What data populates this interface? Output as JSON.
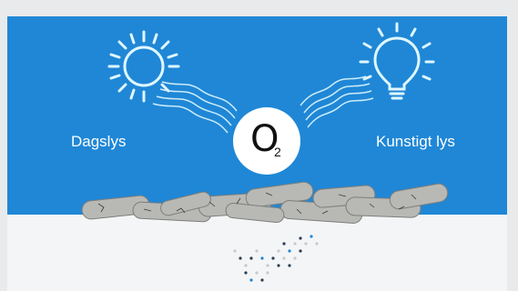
{
  "labels": {
    "daylight": "Dagslys",
    "artificial_light": "Kunstigt lys",
    "o2_main": "O",
    "o2_sub": "2"
  },
  "colors": {
    "background_blue": "#1f87d6",
    "icon_glow": "#dff7ff",
    "pellet": "#b8b9b5",
    "dot_blue": "#1f87d6",
    "dot_dark": "#2c3e50"
  },
  "icons": [
    "sun-icon",
    "light-bulb-icon",
    "light-waves-icon",
    "pellets-illustration",
    "dotted-logo-icon"
  ]
}
